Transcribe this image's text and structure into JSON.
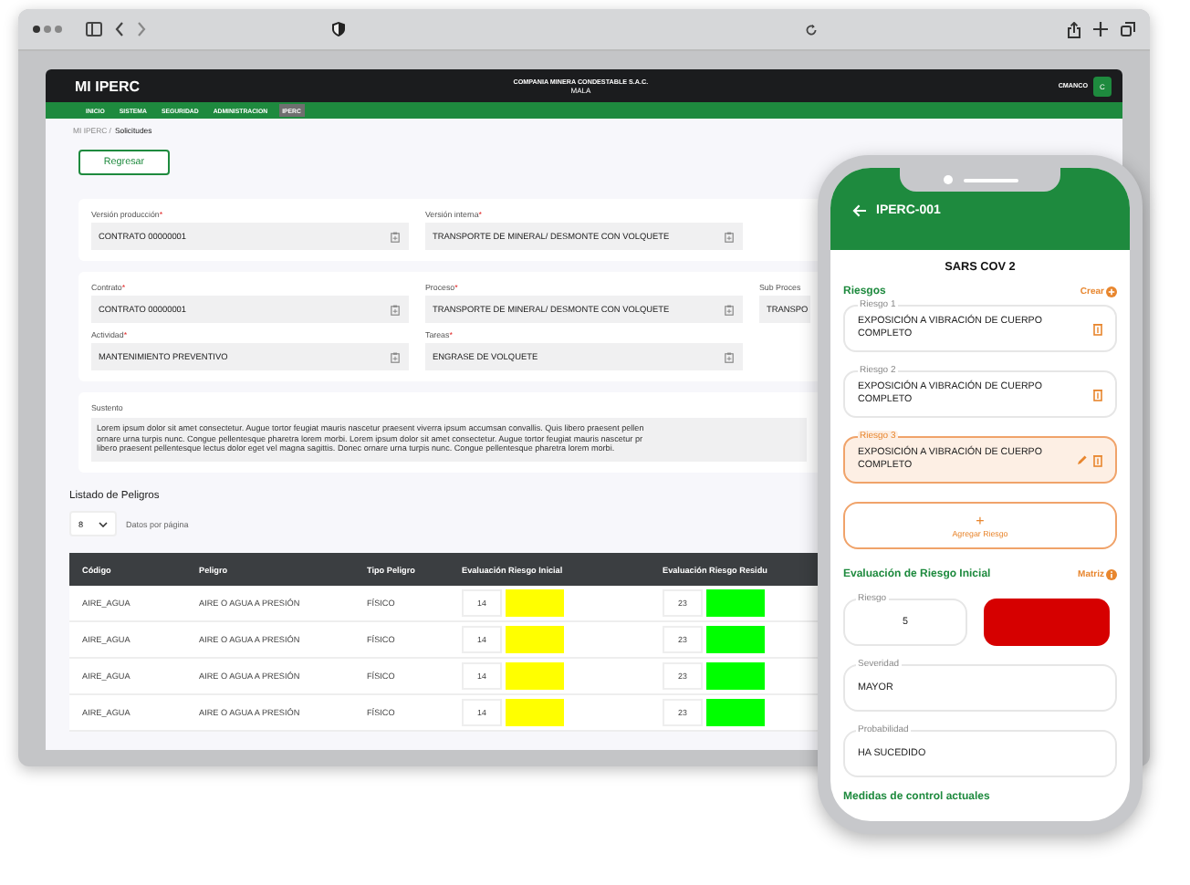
{
  "app": {
    "logo": "MI IPERC",
    "company": "COMPANIA MINERA CONDESTABLE S.A.C.",
    "site": "MALA",
    "user": "CMANCO",
    "avatar": "C"
  },
  "nav": [
    {
      "label": "INICIO",
      "selected": false
    },
    {
      "label": "SISTEMA",
      "selected": false
    },
    {
      "label": "SEGURIDAD",
      "selected": false
    },
    {
      "label": "ADMINISTRACION",
      "selected": false
    },
    {
      "label": "IPERC",
      "selected": true
    }
  ],
  "breadcrumb": {
    "parent": "MI IPERC /",
    "current": "Solicitudes"
  },
  "back_button": "Regresar",
  "version_card": [
    {
      "label": "Versión producción",
      "mark": "*",
      "value": "CONTRATO 00000001",
      "icon": true
    },
    {
      "label": "Versión interna",
      "mark": "*",
      "value": "TRANSPORTE DE MINERAL/ DESMONTE CON VOLQUETE",
      "icon": true
    }
  ],
  "details_card": [
    {
      "label": "Contrato",
      "mark": "*",
      "value": "CONTRATO 00000001",
      "icon": true
    },
    {
      "label": "Proceso",
      "mark": "*",
      "value": "TRANSPORTE DE MINERAL/ DESMONTE CON VOLQUETE",
      "icon": true
    },
    {
      "label": "Sub Proces",
      "value": "TRANSPO",
      "icon": false
    },
    {
      "label": "Actividad",
      "mark": "*",
      "value": "MANTENIMIENTO PREVENTIVO",
      "icon": true
    },
    {
      "label": "Tareas",
      "mark": "*",
      "value": "ENGRASE DE VOLQUETE",
      "icon": true
    }
  ],
  "sustento": {
    "label": "Sustento",
    "lines": [
      "Lorem ipsum dolor sit amet consectetur. Augue tortor feugiat mauris nascetur praesent viverra ipsum accumsan convallis. Quis libero praesent pellen",
      "ornare urna turpis nunc. Congue pellentesque pharetra lorem morbi. Lorem ipsum dolor sit amet consectetur. Augue tortor feugiat mauris nascetur pr",
      "libero praesent pellentesque lectus dolor eget vel magna sagittis. Donec ornare urna turpis nunc. Congue pellentesque pharetra lorem morbi."
    ]
  },
  "peligros": {
    "title": "Listado de Peligros",
    "page_size": "8",
    "page_size_label": "Datos por página",
    "columns": [
      "Código",
      "Peligro",
      "Tipo Peligro",
      "Evaluación Riesgo Inicial",
      "Evaluación Riesgo Residu"
    ],
    "rows": [
      {
        "code": "AIRE_AGUA",
        "hazard": "AIRE O AGUA A PRESIÓN",
        "type": "FÍSICO",
        "initial": {
          "value": "14",
          "color": "#ffff00"
        },
        "residual": {
          "value": "23",
          "color": "#00ff00"
        }
      },
      {
        "code": "AIRE_AGUA",
        "hazard": "AIRE O AGUA A PRESIÓN",
        "type": "FÍSICO",
        "initial": {
          "value": "14",
          "color": "#ffff00"
        },
        "residual": {
          "value": "23",
          "color": "#00ff00"
        }
      },
      {
        "code": "AIRE_AGUA",
        "hazard": "AIRE O AGUA A PRESIÓN",
        "type": "FÍSICO",
        "initial": {
          "value": "14",
          "color": "#ffff00"
        },
        "residual": {
          "value": "23",
          "color": "#00ff00"
        }
      },
      {
        "code": "AIRE_AGUA",
        "hazard": "AIRE O AGUA A PRESIÓN",
        "type": "FÍSICO",
        "initial": {
          "value": "14",
          "color": "#ffff00"
        },
        "residual": {
          "value": "23",
          "color": "#00ff00"
        }
      }
    ]
  },
  "phone": {
    "title": "IPERC-001",
    "subtitle": "SARS COV 2",
    "riesgos_title": "Riesgos",
    "create": "Crear",
    "riesgos": [
      {
        "legend": "Riesgo 1",
        "text": "EXPOSICIÓN A VIBRACIÓN DE CUERPO COMPLETO",
        "selected": false
      },
      {
        "legend": "Riesgo 2",
        "text": "EXPOSICIÓN A VIBRACIÓN DE CUERPO COMPLETO",
        "selected": false
      },
      {
        "legend": "Riesgo 3",
        "text": "EXPOSICIÓN A VIBRACIÓN DE CUERPO COMPLETO",
        "selected": true
      }
    ],
    "add_icon": "+",
    "add_label": "Agregar Riesgo",
    "eval_title": "Evaluación de Riesgo Inicial",
    "matrix": "Matriz",
    "risk": {
      "legend": "Riesgo",
      "value": "5",
      "color": "#d60000"
    },
    "fields": [
      {
        "legend": "Severidad",
        "value": "MAYOR"
      },
      {
        "legend": "Probabilidad",
        "value": "HA SUCEDIDO"
      }
    ],
    "controls_title": "Medidas de control actuales"
  }
}
